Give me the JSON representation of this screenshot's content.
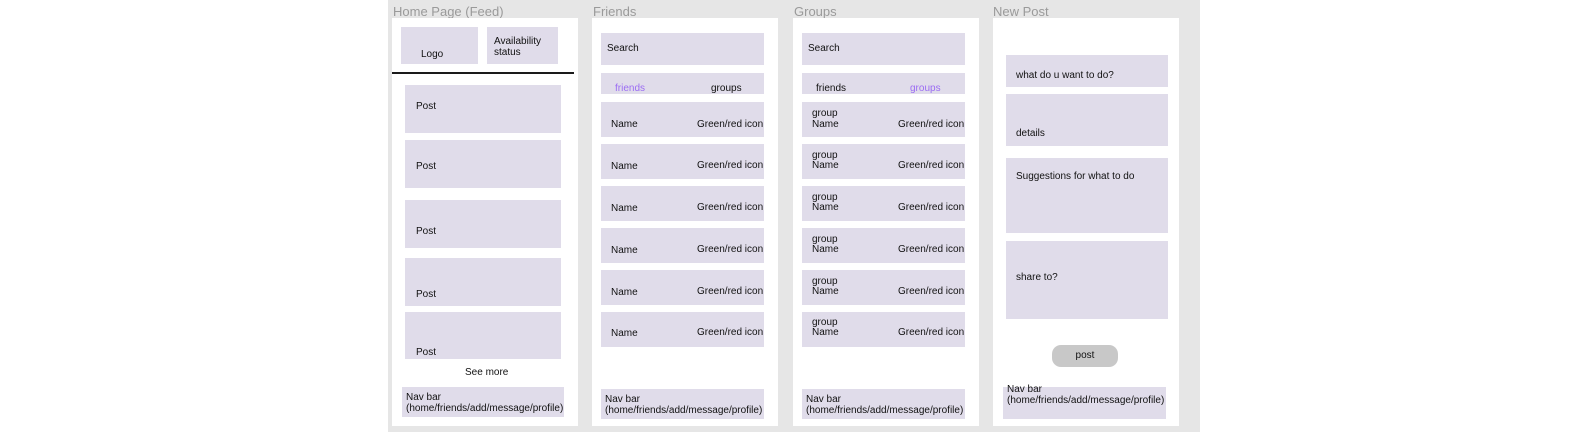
{
  "frames": {
    "home": {
      "title": "Home Page (Feed)",
      "logo": "Logo",
      "availability": [
        "Availability",
        "status"
      ],
      "posts": [
        "Post",
        "Post",
        "Post",
        "Post",
        "Post"
      ],
      "see_more": "See more",
      "nav": [
        "Nav bar",
        "(home/friends/add/message/profile)"
      ]
    },
    "friends": {
      "title": "Friends",
      "search": "Search",
      "tabs": [
        "friends",
        "groups"
      ],
      "rows": [
        {
          "name": "Name",
          "icon": "Green/red icon"
        },
        {
          "name": "Name",
          "icon": "Green/red icon"
        },
        {
          "name": "Name",
          "icon": "Green/red icon"
        },
        {
          "name": "Name",
          "icon": "Green/red icon"
        },
        {
          "name": "Name",
          "icon": "Green/red icon"
        },
        {
          "name": "Name",
          "icon": "Green/red icon"
        }
      ],
      "nav": [
        "Nav bar",
        "(home/friends/add/message/profile)"
      ]
    },
    "groups": {
      "title": "Groups",
      "search": "Search",
      "tabs": [
        "friends",
        "groups"
      ],
      "rows": [
        {
          "name": [
            "group",
            "Name"
          ],
          "icon": "Green/red icon"
        },
        {
          "name": [
            "group",
            "Name"
          ],
          "icon": "Green/red icon"
        },
        {
          "name": [
            "group",
            "Name"
          ],
          "icon": "Green/red icon"
        },
        {
          "name": [
            "group",
            "Name"
          ],
          "icon": "Green/red icon"
        },
        {
          "name": [
            "group",
            "Name"
          ],
          "icon": "Green/red icon"
        },
        {
          "name": [
            "group",
            "Name"
          ],
          "icon": "Green/red icon"
        }
      ],
      "nav": [
        "Nav bar",
        "(home/friends/add/message/profile)"
      ]
    },
    "newpost": {
      "title": "New Post",
      "what": "what do u want to do?",
      "details": "details",
      "suggestions": "Suggestions for what to do",
      "share": "share to?",
      "post_button": "post",
      "nav": [
        "Nav bar",
        "(home/friends/add/message/profile)"
      ]
    }
  },
  "colors": {
    "canvas": "#e6e6e6",
    "box_fill": "#e0dcea",
    "accent": "#9b6cf3",
    "button": "#c8c8c8"
  }
}
